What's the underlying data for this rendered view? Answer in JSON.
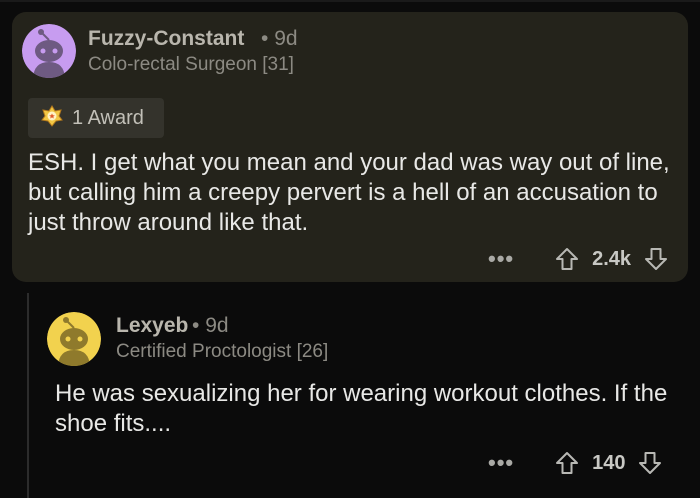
{
  "comment1": {
    "username": "Fuzzy-Constant",
    "age": "9d",
    "flair": "Colo-rectal Surgeon [31]",
    "award_label": "1 Award",
    "body": "ESH.  I get what you mean and your dad was way out of line, but calling him a creepy pervert is a hell of an accusation to just throw around like that.",
    "more_icon": "ellipsis-icon",
    "score": "2.4k",
    "avatar_color": "#c79cf0"
  },
  "comment2": {
    "username": "Lexyeb",
    "age": "9d",
    "flair": "Certified Proctologist [26]",
    "body": "He was sexualizing her for wearing workout clothes. If the shoe fits....",
    "more_icon": "ellipsis-icon",
    "score": "140",
    "avatar_color": "#f2d24e"
  },
  "separator": "•",
  "more_label": "•••",
  "colors": {
    "background": "#0b0b0b",
    "highlight_card": "#24231b",
    "text": "#e8e8e6",
    "muted": "#8c8a83"
  }
}
